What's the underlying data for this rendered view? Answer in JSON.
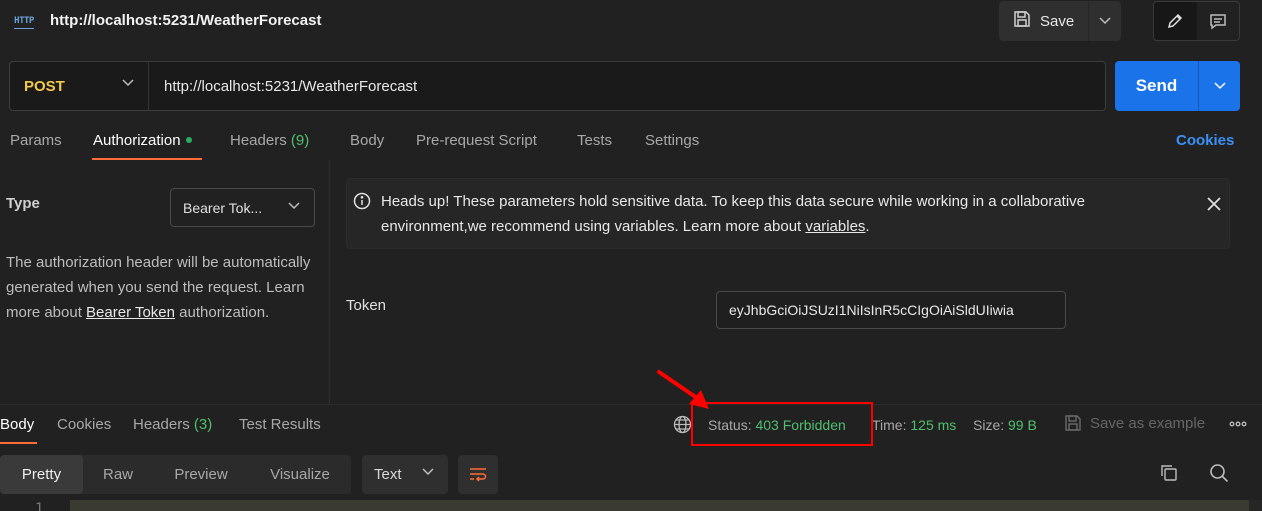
{
  "header": {
    "badge": "HTTP",
    "title": "http://localhost:5231/WeatherForecast",
    "save_label": "Save"
  },
  "request": {
    "method": "POST",
    "url": "http://localhost:5231/WeatherForecast",
    "send_label": "Send"
  },
  "tabs": {
    "params": "Params",
    "authorization": "Authorization",
    "headers": "Headers",
    "headers_count": "(9)",
    "body": "Body",
    "prerequest": "Pre-request Script",
    "tests": "Tests",
    "settings": "Settings",
    "cookies": "Cookies"
  },
  "auth": {
    "type_label": "Type",
    "type_value": "Bearer Tok...",
    "description": "The authorization header will be automatically generated when you send the request. Learn more about ",
    "link": "Bearer Token",
    "description_tail": " authorization.",
    "banner_text": "Heads up! These parameters hold sensitive data. To keep this data secure while working in a collaborative environment,we recommend using variables. Learn more about ",
    "banner_link": "variables",
    "banner_end": ".",
    "token_label": "Token",
    "token_value": "eyJhbGciOiJSUzI1NiIsInR5cCIgOiAiSldUIiwia"
  },
  "response": {
    "tabs": {
      "body": "Body",
      "cookies": "Cookies",
      "headers": "Headers",
      "headers_count": "(3)",
      "test_results": "Test Results"
    },
    "status_label": "Status:",
    "status_value": "403 Forbidden",
    "time_label": "Time:",
    "time_value": "125 ms",
    "size_label": "Size:",
    "size_value": "99 B",
    "save_example": "Save as example",
    "views": [
      "Pretty",
      "Raw",
      "Preview",
      "Visualize"
    ],
    "format": "Text",
    "line_number": "1"
  },
  "colors": {
    "accent": "#ff6c37",
    "send_blue": "#1a73e8",
    "status_green": "#4fbf6f",
    "method_yellow": "#f2c94c",
    "annotation_red": "#ff0000"
  }
}
